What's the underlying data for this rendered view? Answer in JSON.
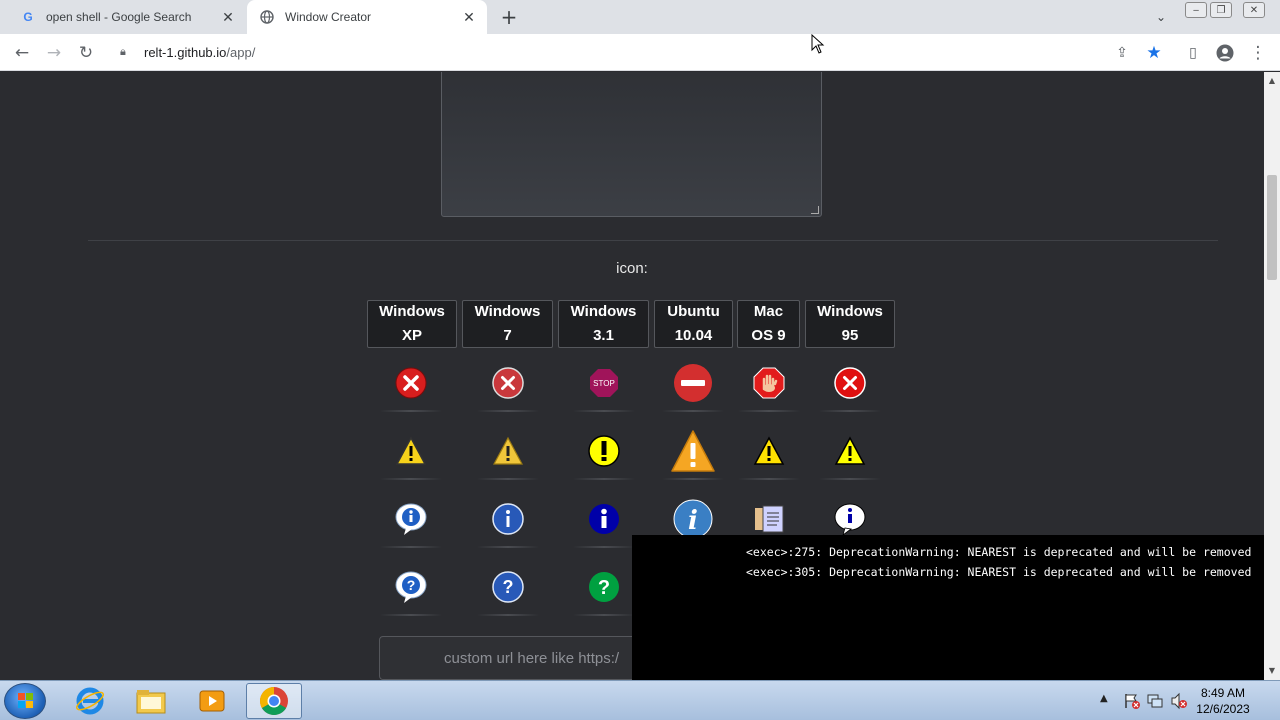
{
  "browser": {
    "tabs": [
      {
        "title": "open shell - Google Search",
        "favicon": "google-icon",
        "active": false
      },
      {
        "title": "Window Creator",
        "favicon": "globe-icon",
        "active": true
      }
    ],
    "url_host": "relt-1.github.io",
    "url_path": "/app/"
  },
  "page": {
    "icon_label": "icon:",
    "os_options": [
      {
        "line1": "Windows",
        "line2": "XP"
      },
      {
        "line1": "Windows",
        "line2": "7"
      },
      {
        "line1": "Windows",
        "line2": "3.1"
      },
      {
        "line1": "Ubuntu",
        "line2": "10.04"
      },
      {
        "line1": "Mac",
        "line2": "OS 9"
      },
      {
        "line1": "Windows",
        "line2": "95"
      }
    ],
    "icon_rows": [
      "error",
      "warning",
      "info",
      "question"
    ],
    "custom_url_placeholder": "custom url here like https:/"
  },
  "console": {
    "lines": [
      "<exec>:275: DeprecationWarning: NEAREST is deprecated and will be removed",
      "<exec>:305: DeprecationWarning: NEAREST is deprecated and will be removed"
    ]
  },
  "taskbar": {
    "time": "8:49 AM",
    "date": "12/6/2023"
  }
}
